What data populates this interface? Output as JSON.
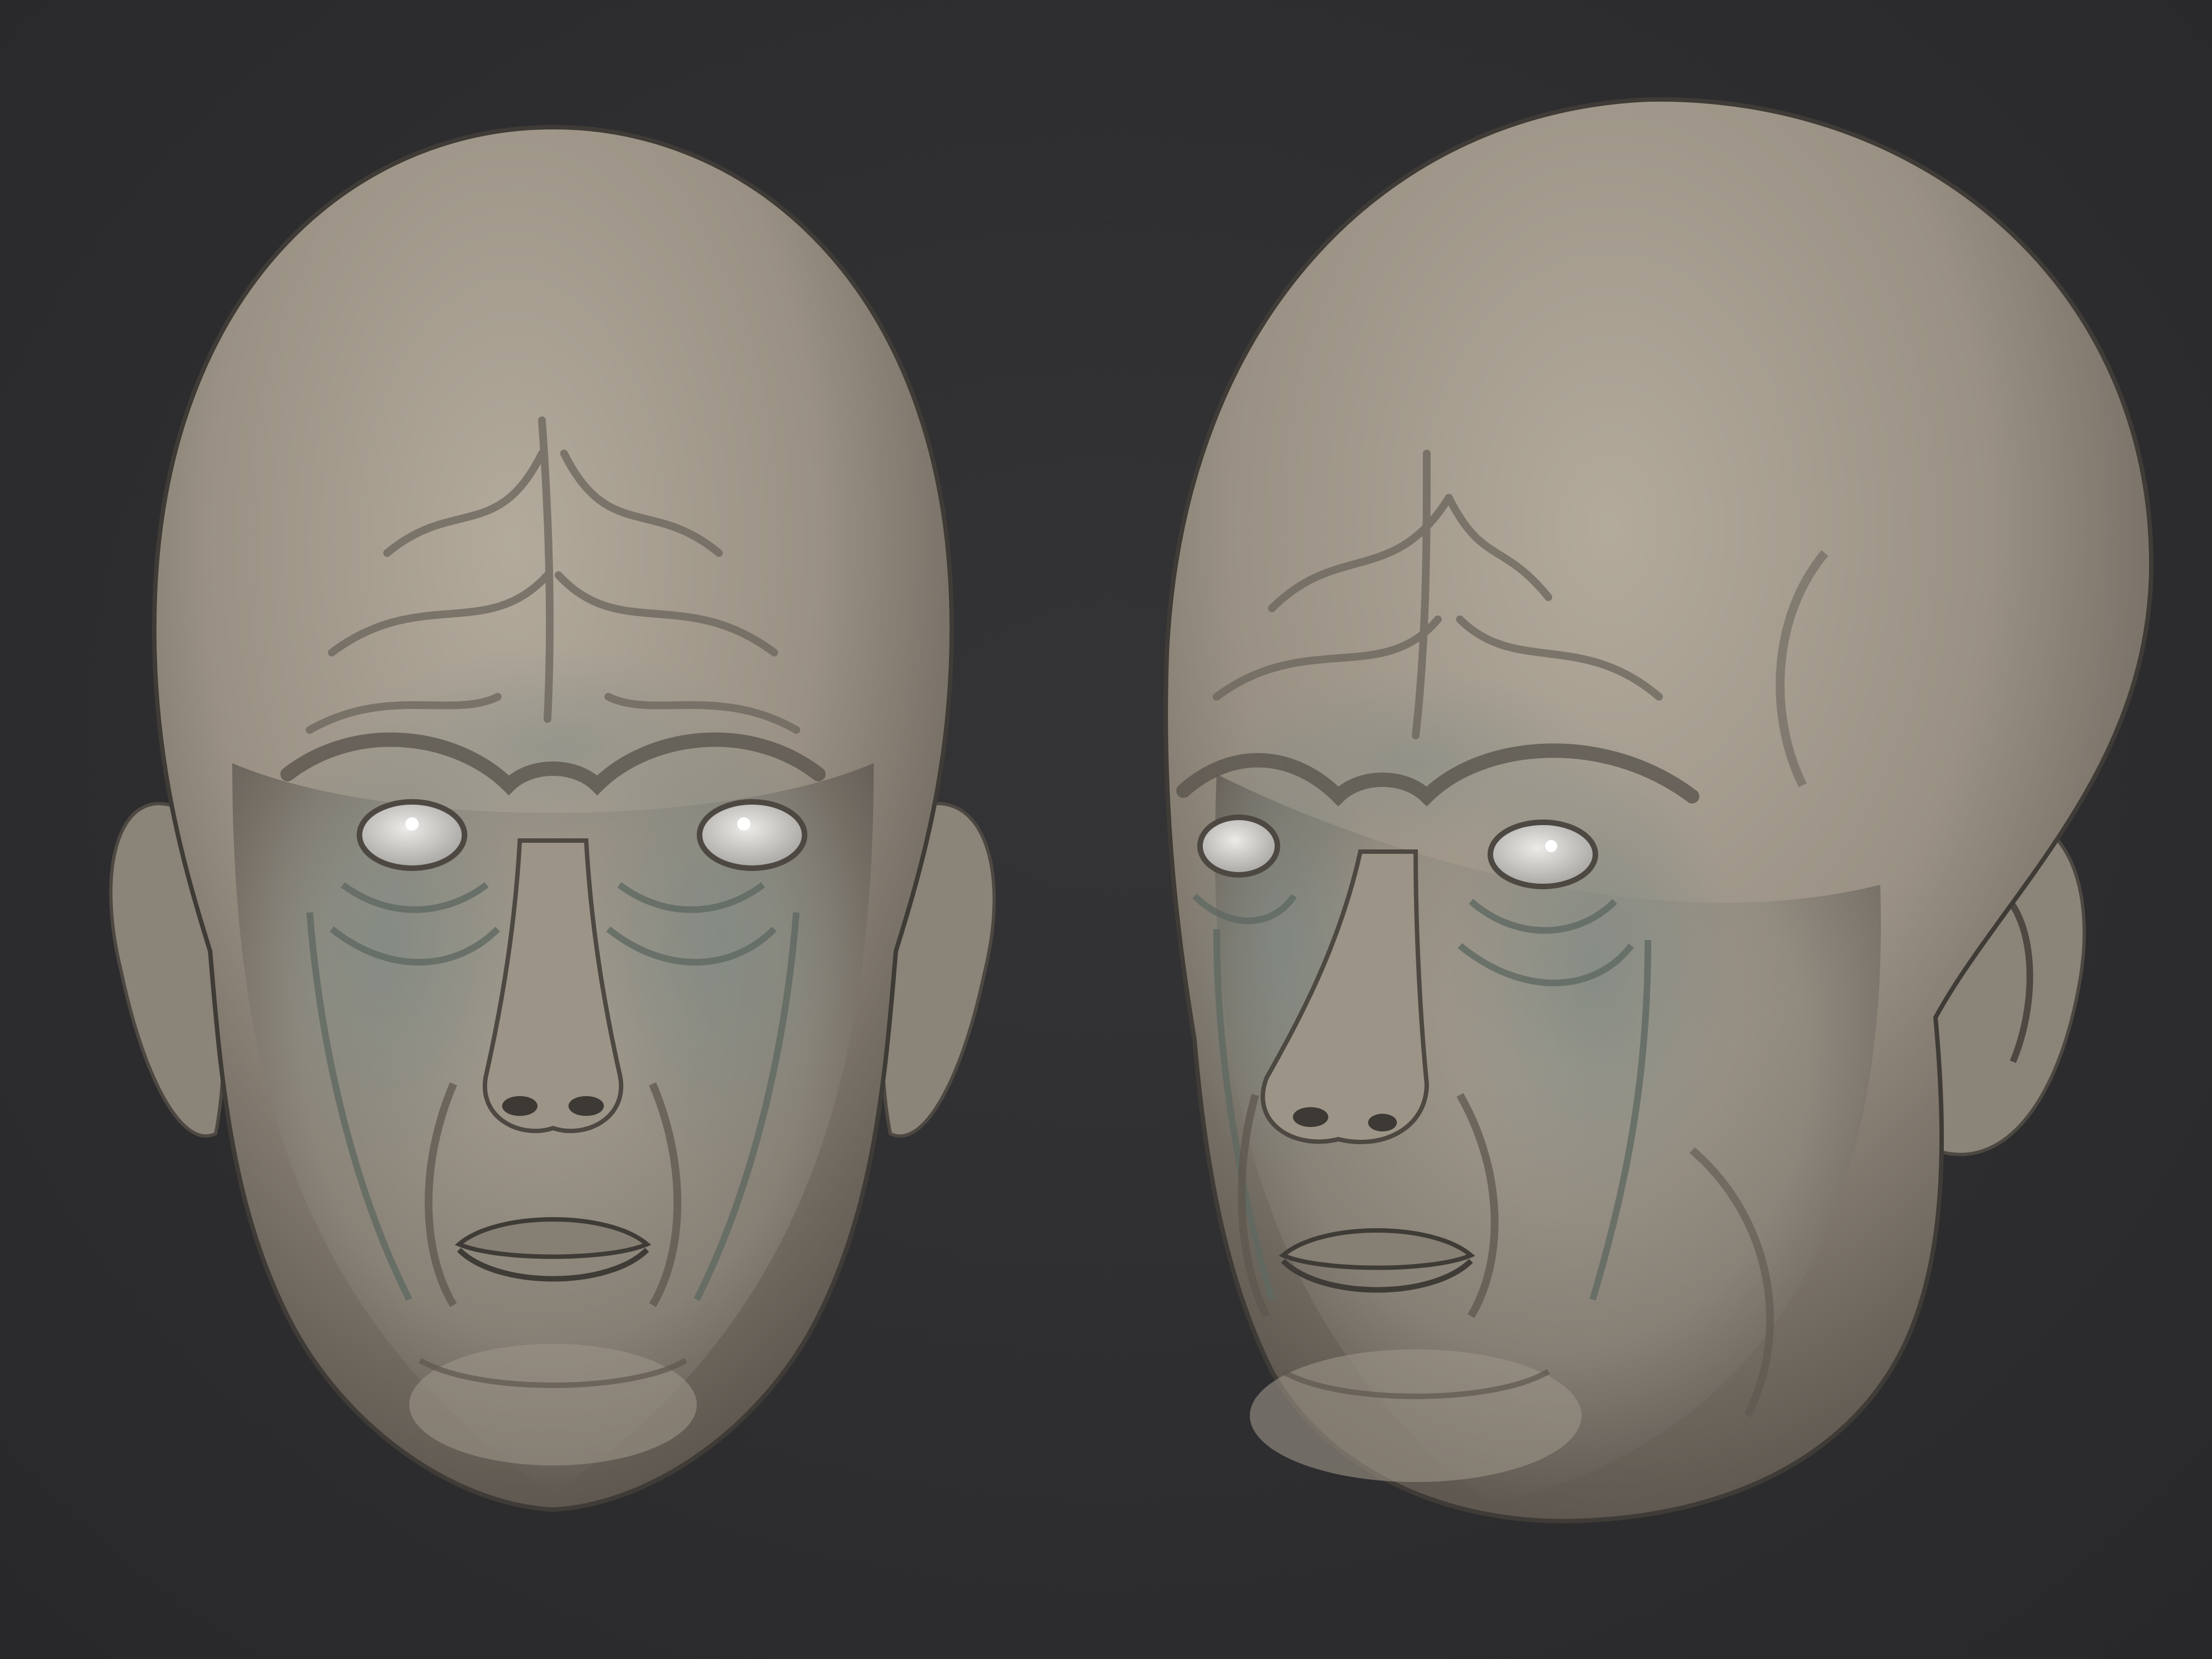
{
  "scene": {
    "background_color": "#2e2e30",
    "clay_color": "#a39b8f",
    "clay_shadow_color": "#5e5850",
    "tint_color": "#7f8a84",
    "eye_color": "#dcdad6"
  },
  "models": [
    {
      "view": "front"
    },
    {
      "view": "three-quarter"
    }
  ]
}
